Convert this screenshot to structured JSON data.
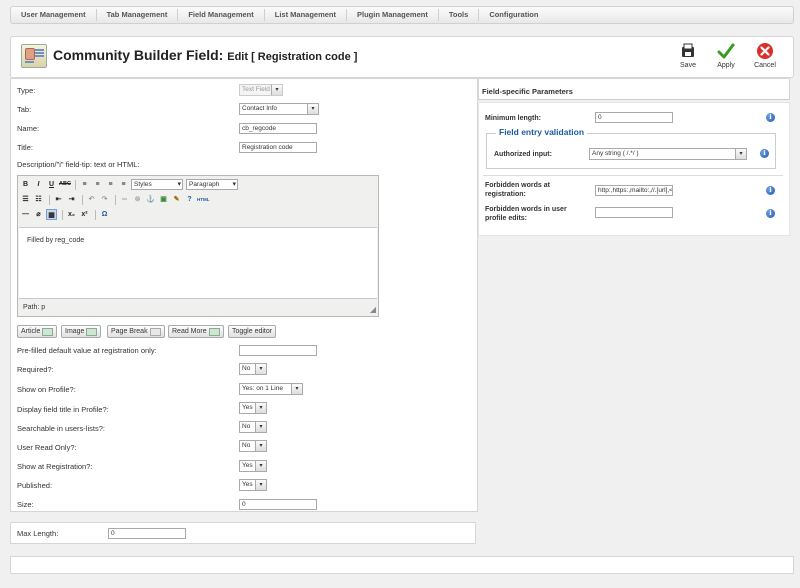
{
  "menu": [
    "User Management",
    "Tab Management",
    "Field Management",
    "List Management",
    "Plugin Management",
    "Tools",
    "Configuration"
  ],
  "header": {
    "title": "Community Builder Field:",
    "subtitle": "Edit [ Registration code ]",
    "save_label": "Save",
    "apply_label": "Apply",
    "cancel_label": "Cancel"
  },
  "form": {
    "type_label": "Type:",
    "type_value": "Text Field",
    "tab_label": "Tab:",
    "tab_value": "Contact Info",
    "name_label": "Name:",
    "name_value": "cb_regcode",
    "title_label": "Title:",
    "title_value": "Registration code",
    "description_label": "Description/\"i\" field-tip: text or HTML:"
  },
  "editor": {
    "styles_label": "Styles",
    "format_label": "Paragraph",
    "content": "Filled by reg_code",
    "path": "Path: p",
    "buttons": [
      "Article",
      "Image",
      "Page Break",
      "Read More",
      "Toggle editor"
    ]
  },
  "options": {
    "prefilled_label": "Pre-filled default value at registration only:",
    "prefilled_value": "",
    "required_label": "Required?:",
    "required_value": "No",
    "show_profile_label": "Show on Profile?:",
    "show_profile_value": "Yes: on 1 Line",
    "display_title_label": "Display field title in Profile?:",
    "display_title_value": "Yes",
    "searchable_label": "Searchable in users-lists?:",
    "searchable_value": "No",
    "readonly_label": "User Read Only?:",
    "readonly_value": "No",
    "show_reg_label": "Show at Registration?:",
    "show_reg_value": "Yes",
    "published_label": "Published:",
    "published_value": "Yes",
    "size_label": "Size:",
    "size_value": "0",
    "maxlength_label": "Max Length:",
    "maxlength_value": "0"
  },
  "params": {
    "tab_title": "Field-specific Parameters",
    "min_length_label": "Minimum length:",
    "min_length_value": "0",
    "validation_legend": "Field entry validation",
    "authorized_label": "Authorized input:",
    "authorized_value": "Any string ( /.*/ )",
    "forbidden_reg_label_1": "Forbidden words at",
    "forbidden_reg_label_2": "registration:",
    "forbidden_reg_value": "http:,https:,mailto:,//.[url],<a,</a",
    "forbidden_edit_label_1": "Forbidden words in user",
    "forbidden_edit_label_2": "profile edits:",
    "forbidden_edit_value": ""
  },
  "colors": {
    "accent_blue": "#1e5aa0",
    "apply_green": "#3a9d23",
    "cancel_red": "#d9302a"
  }
}
